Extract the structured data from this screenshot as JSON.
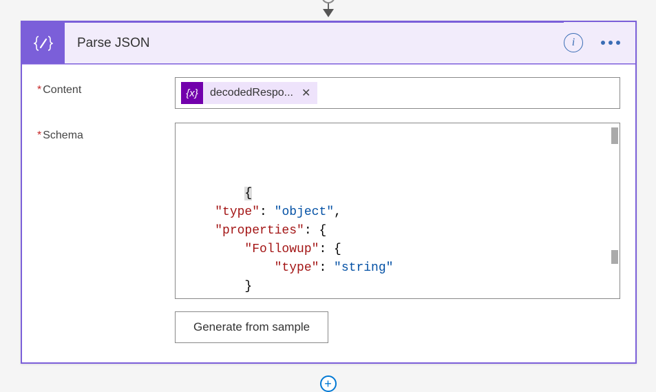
{
  "header": {
    "icon_label": "code-braces-icon",
    "title": "Parse JSON"
  },
  "fields": {
    "content": {
      "label": "Content",
      "token_name": "decodedRespo...",
      "token_fx_label": "{x}"
    },
    "schema": {
      "label": "Schema",
      "lines": [
        {
          "indent": 0,
          "tokens": [
            {
              "t": "b",
              "v": "{",
              "hl": true
            }
          ]
        },
        {
          "indent": 1,
          "tokens": [
            {
              "t": "k",
              "v": "\"type\""
            },
            {
              "t": "b",
              "v": ": "
            },
            {
              "t": "s",
              "v": "\"object\""
            },
            {
              "t": "b",
              "v": ","
            }
          ]
        },
        {
          "indent": 1,
          "tokens": [
            {
              "t": "k",
              "v": "\"properties\""
            },
            {
              "t": "b",
              "v": ": {"
            }
          ]
        },
        {
          "indent": 2,
          "tokens": [
            {
              "t": "k",
              "v": "\"Followup\""
            },
            {
              "t": "b",
              "v": ": {"
            }
          ]
        },
        {
          "indent": 3,
          "tokens": [
            {
              "t": "k",
              "v": "\"type\""
            },
            {
              "t": "b",
              "v": ": "
            },
            {
              "t": "s",
              "v": "\"string\""
            }
          ]
        },
        {
          "indent": 2,
          "tokens": [
            {
              "t": "b",
              "v": "}"
            }
          ]
        },
        {
          "indent": 1,
          "tokens": [
            {
              "t": "b",
              "v": "}"
            }
          ]
        },
        {
          "indent": 0,
          "tokens": [
            {
              "t": "b",
              "v": "}",
              "hl": true
            }
          ]
        }
      ]
    }
  },
  "buttons": {
    "generate": "Generate from sample"
  }
}
